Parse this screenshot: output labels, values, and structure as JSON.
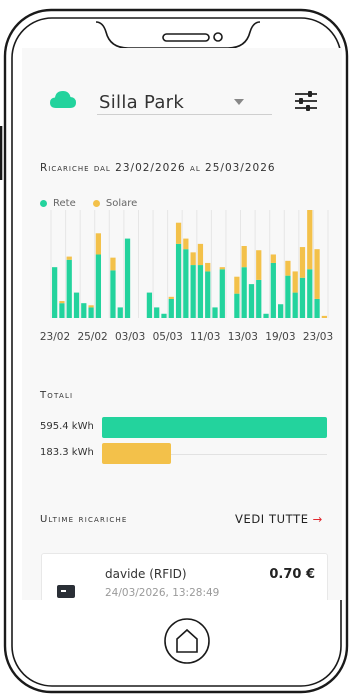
{
  "header": {
    "site_name": "Silla Park",
    "cloud_icon": "cloud-icon",
    "filter_icon": "sliders-icon"
  },
  "colors": {
    "grid": "#23d39d",
    "solar": "#f3c14a",
    "accent_arrow": "#e0282e"
  },
  "range_title": "Ricariche dal 23/02/2026 al 25/03/2026",
  "chart_data": {
    "type": "bar",
    "stacked": true,
    "legend": [
      "Rete",
      "Solare"
    ],
    "legend_position": "top-left",
    "x_tick_labels": [
      "23/02",
      "25/02",
      "03/03",
      "05/03",
      "11/03",
      "13/03",
      "19/03",
      "23/03"
    ],
    "series": [
      {
        "name": "Rete",
        "values": [
          48,
          14,
          55,
          24,
          14,
          10,
          60,
          0,
          45,
          10,
          75,
          0,
          0,
          24,
          10,
          4,
          18,
          70,
          65,
          50,
          50,
          44,
          10,
          46,
          0,
          23,
          48,
          32,
          36,
          4,
          52,
          13,
          40,
          24,
          38,
          46,
          18,
          0
        ]
      },
      {
        "name": "Solare",
        "values": [
          0,
          2,
          3,
          0,
          0,
          2,
          20,
          0,
          12,
          0,
          0,
          0,
          0,
          0,
          0,
          0,
          2,
          20,
          10,
          12,
          20,
          8,
          0,
          2,
          0,
          16,
          20,
          0,
          28,
          0,
          8,
          0,
          14,
          20,
          29,
          56,
          47,
          2
        ]
      }
    ]
  },
  "totals": {
    "title": "Totali",
    "grid_label": "595.4 kWh",
    "grid_value": 595.4,
    "solar_label": "183.3 kWh",
    "solar_value": 183.3
  },
  "recent": {
    "title": "Ultime ricariche",
    "see_all": "VEDI TUTTE",
    "arrow": "→",
    "card": {
      "icon": "rfid-card-icon",
      "user": "davide (RFID)",
      "date": "24/03/2026, 13:28:49",
      "amount": "0.70 €"
    }
  }
}
